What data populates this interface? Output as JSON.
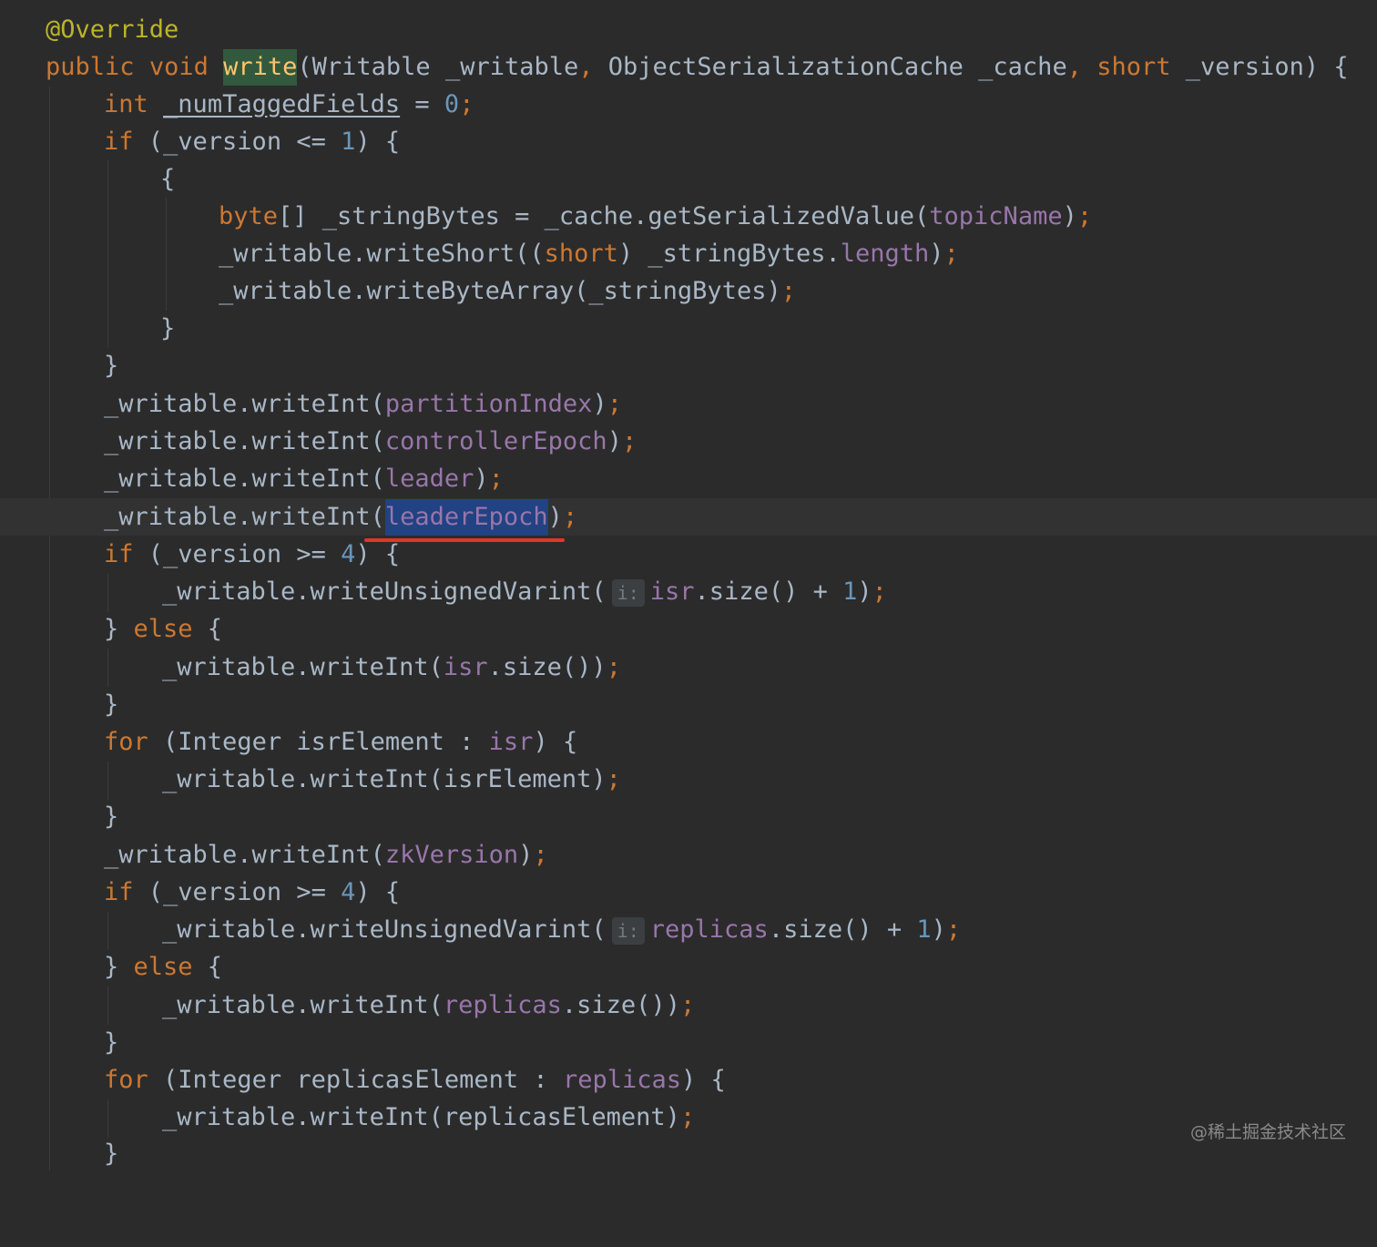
{
  "editor": {
    "lines": {
      "l01": {
        "t1": "@Override"
      },
      "l02": {
        "t1": "public",
        "t2": "void",
        "t3": "write",
        "t4": "(Writable _writable",
        "t5": ",",
        "t6": "ObjectSerializationCache _cache",
        "t7": ",",
        "t8": "short",
        "t9": "_version) {"
      },
      "l03": {
        "t1": "int",
        "t2": "_numTaggedFields",
        "t3": " = ",
        "t4": "0",
        "t5": ";"
      },
      "l04": {
        "t1": "if",
        "t2": " (_version <= ",
        "t3": "1",
        "t4": ") {"
      },
      "l05": {
        "t1": "{"
      },
      "l06": {
        "t1": "byte",
        "t2": "[] _stringBytes = _cache.getSerializedValue(",
        "t3": "topicName",
        "t4": ")",
        "t5": ";"
      },
      "l07": {
        "t1": "_writable.writeShort((",
        "t2": "short",
        "t3": ") _stringBytes.",
        "t4": "length",
        "t5": ")",
        "t6": ";"
      },
      "l08": {
        "t1": "_writable.writeByteArray(_stringBytes)",
        "t2": ";"
      },
      "l09": {
        "t1": "}"
      },
      "l10": {
        "t1": "}"
      },
      "l11": {
        "t1": "_writable.writeInt(",
        "t2": "partitionIndex",
        "t3": ")",
        "t4": ";"
      },
      "l12": {
        "t1": "_writable.writeInt(",
        "t2": "controllerEpoch",
        "t3": ")",
        "t4": ";"
      },
      "l13": {
        "t1": "_writable.writeInt(",
        "t2": "leader",
        "t3": ")",
        "t4": ";"
      },
      "l14": {
        "t1": "_writable.writeInt(",
        "t2": "leaderEpoch",
        "t3": ")",
        "t4": ";"
      },
      "l15": {
        "t1": "if",
        "t2": " (_version >= ",
        "t3": "4",
        "t4": ") {"
      },
      "l16": {
        "t1": "_writable.writeUnsignedVarint(",
        "hint": "i:",
        "t2": "isr",
        "t3": ".size() + ",
        "t4": "1",
        "t5": ")",
        "t6": ";"
      },
      "l17": {
        "t1": "} ",
        "t2": "else",
        "t3": " {"
      },
      "l18": {
        "t1": "_writable.writeInt(",
        "t2": "isr",
        "t3": ".size())",
        "t4": ";"
      },
      "l19": {
        "t1": "}"
      },
      "l20": {
        "t1": "for",
        "t2": " (Integer isrElement : ",
        "t3": "isr",
        "t4": ") {"
      },
      "l21": {
        "t1": "_writable.writeInt(isrElement)",
        "t2": ";"
      },
      "l22": {
        "t1": "}"
      },
      "l23": {
        "t1": "_writable.writeInt(",
        "t2": "zkVersion",
        "t3": ")",
        "t4": ";"
      },
      "l24": {
        "t1": "if",
        "t2": " (_version >= ",
        "t3": "4",
        "t4": ") {"
      },
      "l25": {
        "t1": "_writable.writeUnsignedVarint(",
        "hint": "i:",
        "t2": "replicas",
        "t3": ".size() + ",
        "t4": "1",
        "t5": ")",
        "t6": ";"
      },
      "l26": {
        "t1": "} ",
        "t2": "else",
        "t3": " {"
      },
      "l27": {
        "t1": "_writable.writeInt(",
        "t2": "replicas",
        "t3": ".size())",
        "t4": ";"
      },
      "l28": {
        "t1": "}"
      },
      "l29": {
        "t1": "for",
        "t2": " (Integer replicasElement : ",
        "t3": "replicas",
        "t4": ") {"
      },
      "l30": {
        "t1": "_writable.writeInt(replicasElement)",
        "t2": ";"
      },
      "l31": {
        "t1": "}"
      }
    }
  },
  "watermark": "@稀土掘金技术社区",
  "colors": {
    "background": "#2b2b2b",
    "keyword": "#cc7832",
    "annotation": "#bbb529",
    "number": "#6897bb",
    "field": "#9876aa",
    "text": "#a9b7c6",
    "method_declaration": "#ffc66d",
    "usage_highlight": "#32593d",
    "selection": "#214283",
    "marker": "#e0362b"
  }
}
